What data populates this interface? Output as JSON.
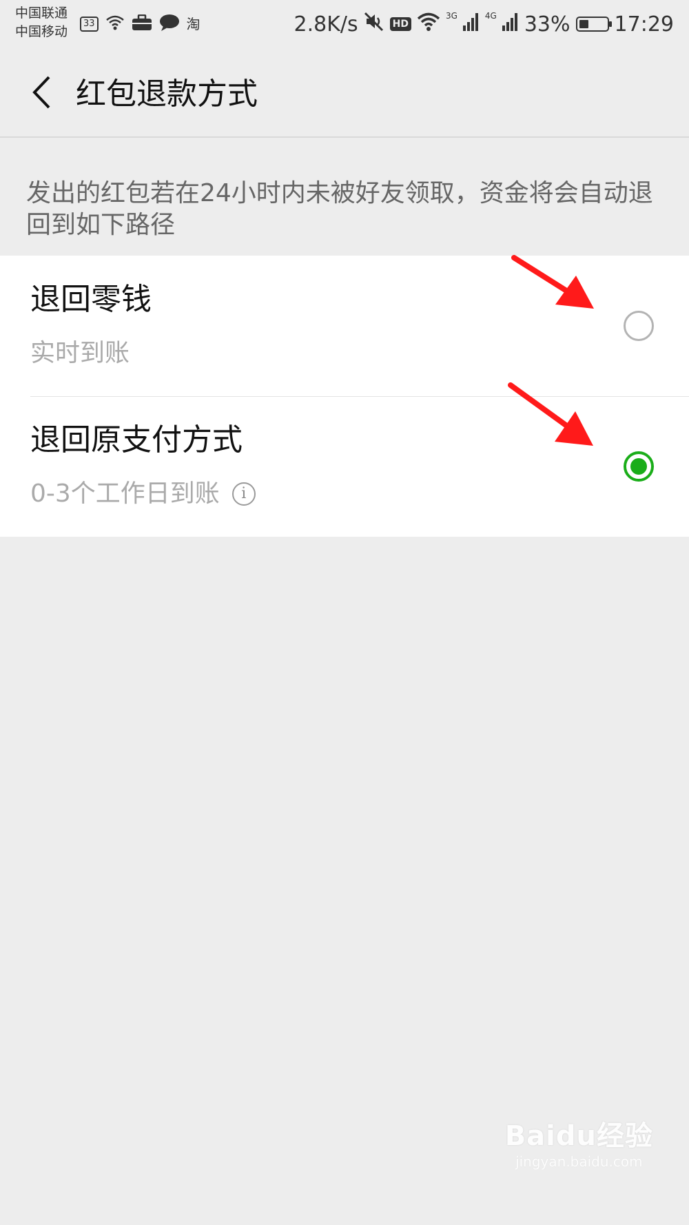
{
  "status_bar": {
    "carrier_1": "中国联通",
    "carrier_2": "中国移动",
    "notif_badge": "33",
    "app_glyph": "淘",
    "net_speed": "2.8K/s",
    "hd_label": "HD",
    "signal_1_label": "3G",
    "signal_2_label": "4G",
    "battery_percent": "33%",
    "battery_level": 0.33,
    "time": "17:29"
  },
  "header": {
    "title": "红包退款方式",
    "back_icon": "chevron-left-icon"
  },
  "description": "发出的红包若在24小时内未被好友领取，资金将会自动退回到如下路径",
  "options": [
    {
      "title": "退回零钱",
      "subtitle": "实时到账",
      "selected": false
    },
    {
      "title": "退回原支付方式",
      "subtitle": "0-3个工作日到账",
      "info_glyph": "i",
      "selected": true
    }
  ],
  "colors": {
    "accent_green": "#1aad19",
    "annotation_red": "#ff1a1a",
    "background": "#ededed"
  },
  "watermark": {
    "logo": "Baidu经验",
    "url": "jingyan.baidu.com"
  }
}
